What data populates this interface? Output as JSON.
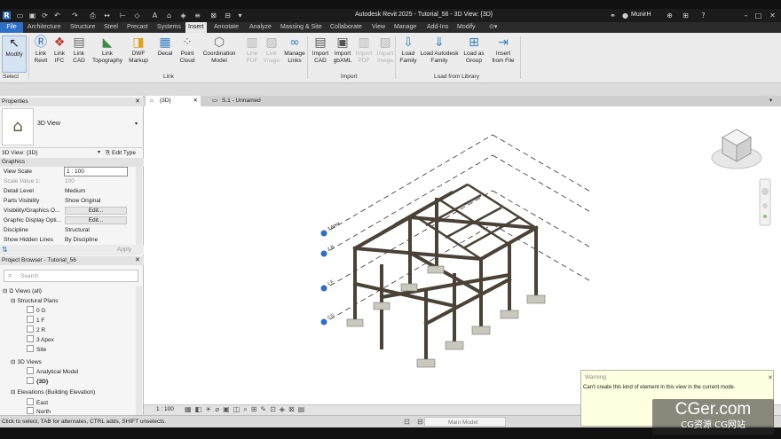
{
  "titlebar": {
    "title": "Autodesk Revit 2025 - Tutorial_56 - 3D View: {3D}",
    "user": "MunirH"
  },
  "tabs": [
    "File",
    "Architecture",
    "Structure",
    "Steel",
    "Precast",
    "Systems",
    "Insert",
    "Annotate",
    "Analyze",
    "Massing & Site",
    "Collaborate",
    "View",
    "Manage",
    "Add-Ins",
    "Modify"
  ],
  "active_tab": "Insert",
  "ribbon": {
    "buttons": [
      {
        "label": "Modify",
        "icon": "cursor-icon"
      },
      {
        "label": "Link\nRevit",
        "icon": "link-revit-icon"
      },
      {
        "label": "Link\nIFC",
        "icon": "link-ifc-icon"
      },
      {
        "label": "Link\nCAD",
        "icon": "link-cad-icon"
      },
      {
        "label": "Link\nTopography",
        "icon": "link-topography-icon"
      },
      {
        "label": "DWF\nMarkup",
        "icon": "dwf-markup-icon"
      },
      {
        "label": "Decal",
        "icon": "decal-icon"
      },
      {
        "label": "Point\nCloud",
        "icon": "point-cloud-icon"
      },
      {
        "label": "Coordination\nModel",
        "icon": "coordination-model-icon"
      },
      {
        "label": "Link\nPDF",
        "icon": "link-pdf-icon"
      },
      {
        "label": "Link\nImage",
        "icon": "link-image-icon"
      },
      {
        "label": "Manage\nLinks",
        "icon": "manage-links-icon"
      },
      {
        "label": "Import\nCAD",
        "icon": "import-cad-icon"
      },
      {
        "label": "Import\ngbXML",
        "icon": "import-gbxml-icon"
      },
      {
        "label": "Import\nPDF",
        "icon": "import-pdf-icon"
      },
      {
        "label": "Import\nImage",
        "icon": "import-image-icon"
      },
      {
        "label": "Load\nFamily",
        "icon": "load-family-icon"
      },
      {
        "label": "Load Autodesk\nFamily",
        "icon": "load-autodesk-family-icon"
      },
      {
        "label": "Load as\nGroup",
        "icon": "load-as-group-icon"
      },
      {
        "label": "Insert\nfrom File",
        "icon": "insert-from-file-icon"
      }
    ],
    "groups": {
      "select": "Select",
      "link": "Link",
      "import": "Import",
      "load_from_library": "Load from Library"
    }
  },
  "view_tabs": [
    {
      "label": "{3D}"
    },
    {
      "label": "S.1 - Unnamed"
    }
  ],
  "properties": {
    "title": "Properties",
    "type_name": "3D View",
    "instance": "3D View: {3D}",
    "edit_type": "Edit Type",
    "section": "Graphics",
    "rows": [
      {
        "key": "View Scale",
        "value": "1 : 100"
      },
      {
        "key": "Scale Value    1:",
        "value": "100"
      },
      {
        "key": "Detail Level",
        "value": "Medium"
      },
      {
        "key": "Parts Visibility",
        "value": "Show Original"
      },
      {
        "key": "Visibility/Graphics O...",
        "value": "Edit..."
      },
      {
        "key": "Graphic Display Opti...",
        "value": "Edit..."
      },
      {
        "key": "Discipline",
        "value": "Structural"
      },
      {
        "key": "Show Hidden Lines",
        "value": "By Discipline"
      }
    ],
    "apply": "Apply"
  },
  "browser": {
    "title": "Project Browser - Tutorial_56",
    "search_placeholder": "Search",
    "items": [
      {
        "label": "Views (all)",
        "level": 0
      },
      {
        "label": "Structural Plans",
        "level": 1
      },
      {
        "label": "0 G",
        "level": 2
      },
      {
        "label": "1 F",
        "level": 2
      },
      {
        "label": "2 R",
        "level": 2
      },
      {
        "label": "3 Apex",
        "level": 2
      },
      {
        "label": "Site",
        "level": 2
      },
      {
        "label": "3D Views",
        "level": 1
      },
      {
        "label": "Analytical Model",
        "level": 2
      },
      {
        "label": "{3D}",
        "level": 2
      },
      {
        "label": "Elevations (Building Elevation)",
        "level": 1
      },
      {
        "label": "East",
        "level": 2
      },
      {
        "label": "North",
        "level": 2
      }
    ]
  },
  "viewport": {
    "levels": [
      "3 Apex",
      "2 R",
      "1 F",
      "0 G"
    ]
  },
  "view_bar": {
    "scale": "1 : 100"
  },
  "status": {
    "text": "Click to select, TAB for alternates, CTRL adds, SHIFT unselects.",
    "model": "Main Model"
  },
  "warning": {
    "title": "Warning",
    "message": "Can't create this kind of element in this view in the current mode."
  },
  "watermark": {
    "main": "CGer.com",
    "sub": "CG资源 CG网站"
  },
  "colors": {
    "file_tab": "#2d6fc7",
    "steel": "#4a4236",
    "warning_bg": "#ffffe1"
  }
}
